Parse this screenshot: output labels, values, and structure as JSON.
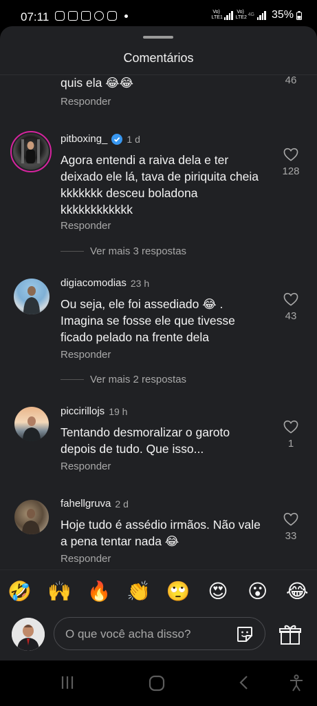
{
  "status": {
    "time": "07:11",
    "sim1": "Vo) LTE1",
    "sim2": "Vo) LTE2",
    "net": "4G",
    "battery": "35%"
  },
  "sheet": {
    "title": "Comentários"
  },
  "comments": [
    {
      "username": "",
      "time": "",
      "text": "quis ela 😂😂",
      "reply": "Responder",
      "likes": "46"
    },
    {
      "username": "pitboxing_",
      "verified": true,
      "time": "1 d",
      "text": "Agora entendi a raiva dela e ter deixado ele lá, tava de piriquita cheia kkkkkkk desceu boladona kkkkkkkkkkkk",
      "reply": "Responder",
      "likes": "128",
      "more_replies": "Ver mais 3 respostas"
    },
    {
      "username": "digiacomodias",
      "time": "23 h",
      "text": "Ou seja, ele foi assediado 😂 . Imagina se fosse ele que tivesse ficado pelado na frente dela",
      "reply": "Responder",
      "likes": "43",
      "more_replies": "Ver mais 2 respostas"
    },
    {
      "username": "piccirillojs",
      "time": "19 h",
      "text": "Tentando desmoralizar o garoto depois de tudo.  Que isso...",
      "reply": "Responder",
      "likes": "1"
    },
    {
      "username": "fahellgruva",
      "time": "2 d",
      "text": "Hoje tudo é assédio irmãos. Não vale a pena tentar nada 😂",
      "reply": "Responder",
      "likes": "33"
    }
  ],
  "emoji_bar": [
    "🤣",
    "🙌",
    "🔥",
    "👏",
    "🙄",
    "😍",
    "😮",
    "😂"
  ],
  "composer": {
    "placeholder": "O que você acha disso?"
  },
  "icons": {
    "heart": "heart-outline-icon",
    "verified": "verified-badge-icon",
    "sticker": "sticker-icon",
    "gift": "gift-icon",
    "recents": "recent-apps-icon",
    "home": "home-icon",
    "back": "back-icon",
    "accessibility": "accessibility-icon"
  },
  "colors": {
    "sheet_bg": "#202124",
    "secondary_text": "#a8a8a8",
    "verified_blue": "#3897f0",
    "story_ring": "#d6249f"
  }
}
